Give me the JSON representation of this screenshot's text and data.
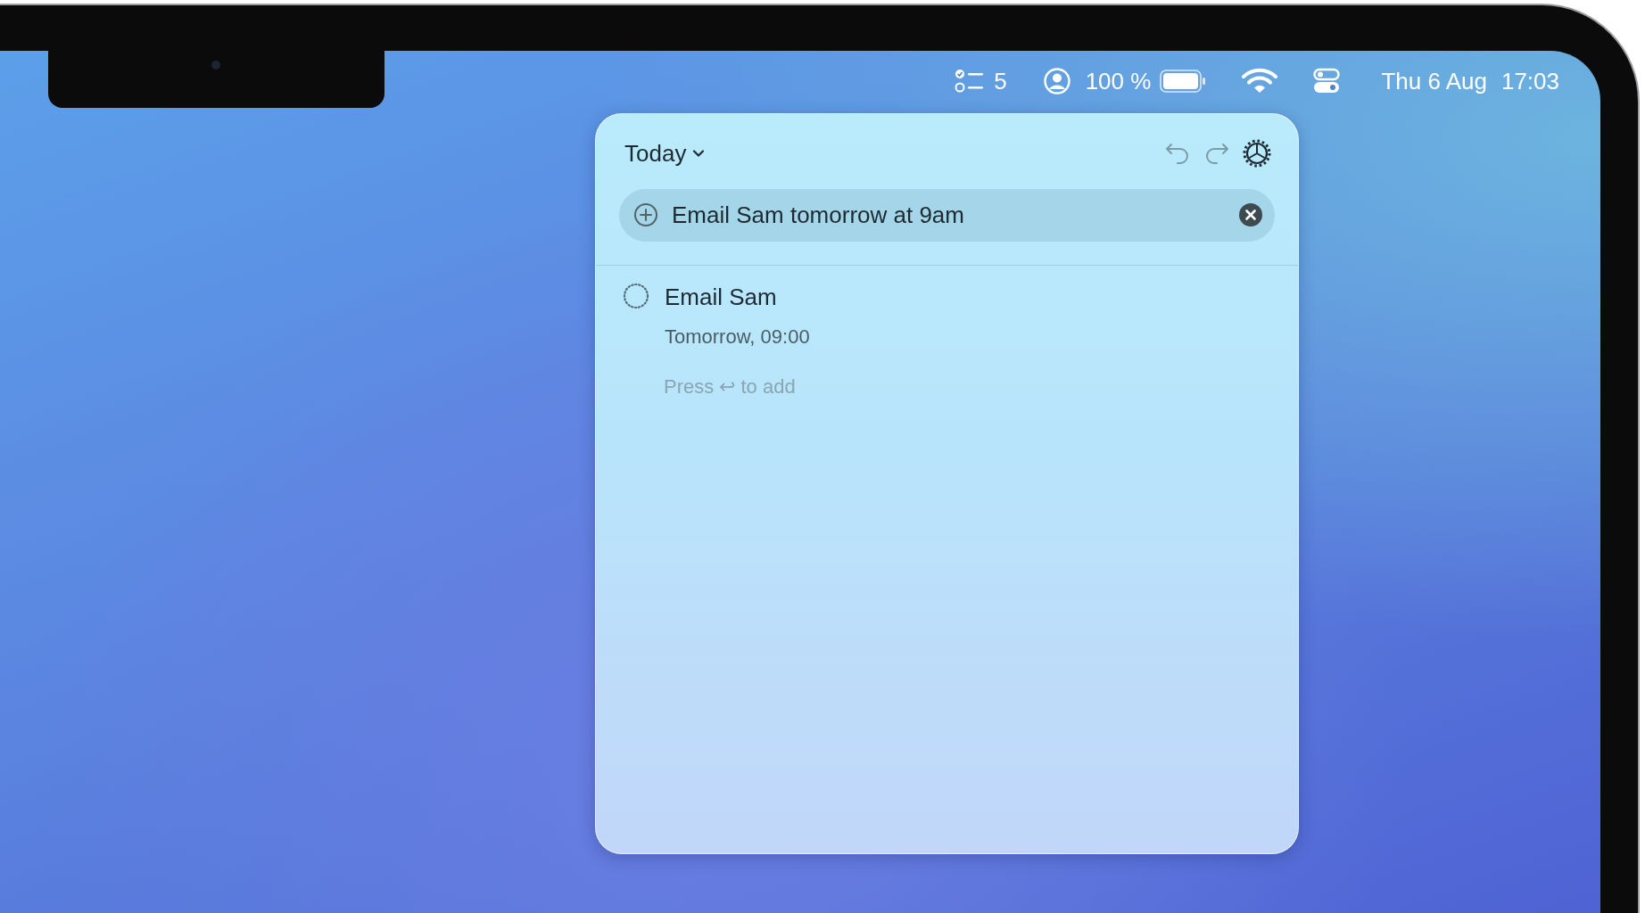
{
  "menu_bar": {
    "reminders_count": "5",
    "battery_percent": "100 %",
    "date": "Thu 6 Aug",
    "time": "17:03"
  },
  "popup": {
    "list_title": "Today",
    "entry": {
      "value": "Email Sam tomorrow at 9am"
    },
    "items": [
      {
        "title": "Email Sam",
        "due": "Tomorrow, 09:00",
        "completed": false
      }
    ],
    "hint": "Press ↩ to add"
  }
}
